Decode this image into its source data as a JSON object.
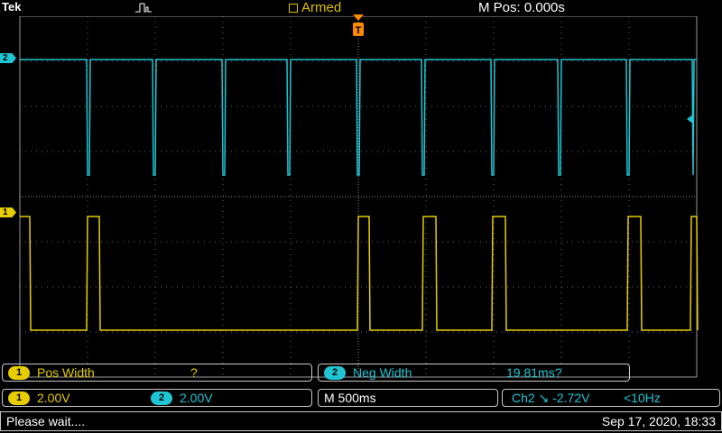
{
  "header": {
    "brand": "Tek",
    "acq_icon": "acquisition-pulse-icon",
    "status": "Armed",
    "mpos": "M Pos: 0.000s"
  },
  "channels": {
    "ch1": {
      "marker": "1",
      "color": "#e6cc00"
    },
    "ch2": {
      "marker": "2",
      "color": "#1fc5d3"
    }
  },
  "measurements": {
    "m1": {
      "badge": "1",
      "label": "Pos Width",
      "value": "?"
    },
    "m2": {
      "badge": "2",
      "label": "Neg Width",
      "value": "19.81ms?"
    }
  },
  "settings": {
    "ch1_badge": "1",
    "ch1_scale": "2.00V",
    "ch2_badge": "2",
    "ch2_scale": "2.00V",
    "timebase": "M 500ms",
    "trigger": "Ch2 ↘ -2.72V",
    "trigger_freq": "<10Hz"
  },
  "footer": {
    "message": "Please wait....",
    "datetime": "Sep 17, 2020, 18:33"
  }
}
